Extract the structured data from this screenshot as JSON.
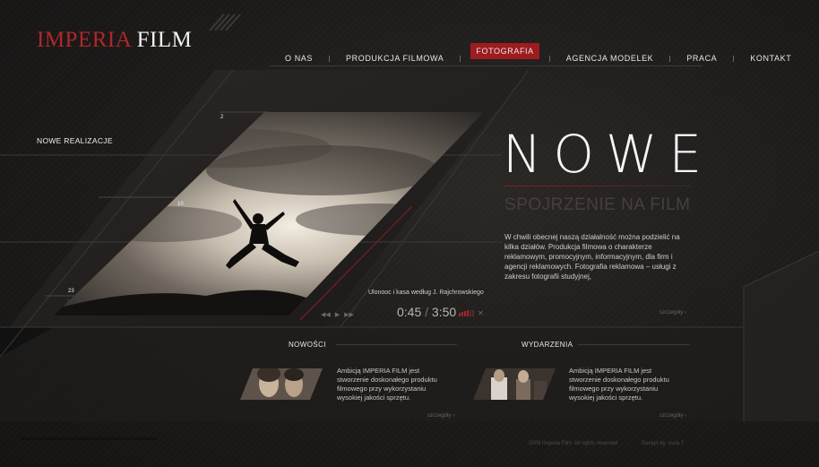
{
  "logo": {
    "part1": "IMPERIA",
    "part2": "FILM"
  },
  "nav": {
    "items": [
      {
        "label": "O NAS",
        "active": false
      },
      {
        "label": "PRODUKCJA FILMOWA",
        "active": false
      },
      {
        "label": "FOTOGRAFIA",
        "active": true
      },
      {
        "label": "AGENCJA MODELEK",
        "active": false
      },
      {
        "label": "PRACA",
        "active": false
      },
      {
        "label": "KONTAKT",
        "active": false
      }
    ]
  },
  "side": {
    "label": "NOWE REALIZACJE",
    "numbers": [
      "2",
      "10",
      "23"
    ]
  },
  "hero": {
    "headline": "NOWE",
    "subhead": "SPOJRZENIE NA FILM",
    "description": "W chwili obecnej naszą działalność można podzielić na kilka działów. Produkcja filmowa o charakterze reklamowym, promocyjnym, informacyjnym, dla firm i agencji reklamowych. Fotografia reklamowa – usługi z zakresu fotografii studyjnej,",
    "more": "szczegóły ›"
  },
  "player": {
    "caption": "Ulonooc i kasa według J. Rajchrowskiego",
    "current": "0:45",
    "separator": "/",
    "total": "3:50"
  },
  "news": {
    "title": "NOWOŚCI",
    "text": "Ambicją IMPERIA FILM jest stworzenie doskonałego produktu filmowego przy wykorzystaniu wysokiej jakości sprzętu.",
    "more": "szczegóły ›"
  },
  "events": {
    "title": "WYDARZENIA",
    "text": "Ambicją IMPERIA FILM jest stworzenie doskonałego produktu filmowego przy wykorzystaniu wysokiej jakości sprzętu.",
    "more": "szczegóły ›"
  },
  "footer": {
    "copyright": "2009 Imperia Film. All rights reserved",
    "design": "Design by: eura 7"
  },
  "colors": {
    "accent": "#9e1b1e",
    "logo_red": "#b0262a",
    "background": "#1c1a19"
  }
}
